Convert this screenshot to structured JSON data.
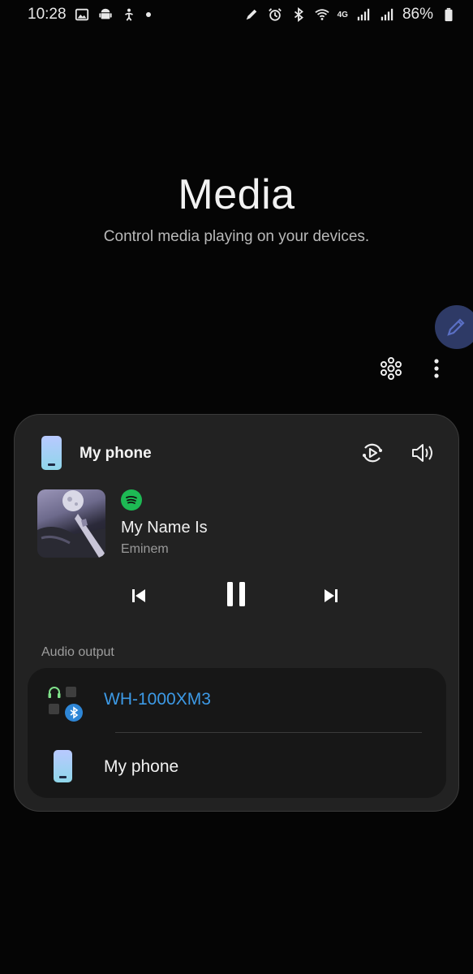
{
  "status_bar": {
    "time": "10:28",
    "battery": "86%",
    "network": "4G",
    "left_icons": [
      "image-icon",
      "android-icon",
      "accessibility-icon",
      "dot-icon"
    ],
    "right_icons": [
      "edit-icon",
      "alarm-icon",
      "bluetooth-icon",
      "wifi-icon",
      "signal-icon",
      "signal-icon",
      "battery-icon"
    ]
  },
  "header": {
    "title": "Media",
    "subtitle": "Control media playing on your devices."
  },
  "actions": {
    "icons": [
      "devices-hub-icon",
      "more-vert-icon"
    ]
  },
  "media_card": {
    "device_name": "My phone",
    "now_playing": {
      "app_icon": "spotify-icon",
      "title": "My Name Is",
      "artist": "Eminem"
    },
    "controls": [
      "previous-icon",
      "pause-icon",
      "next-icon"
    ],
    "audio_output": {
      "label": "Audio output",
      "devices": [
        {
          "name": "WH-1000XM3",
          "icon": "bluetooth-headphones-icon",
          "active": true
        },
        {
          "name": "My phone",
          "icon": "phone-icon",
          "active": false
        }
      ]
    }
  },
  "colors": {
    "background": "#050505",
    "card": "#222222",
    "output_panel": "#171717",
    "active_output": "#3d9ae6",
    "spotify_green": "#1db954",
    "fab": "#2e3a66"
  }
}
